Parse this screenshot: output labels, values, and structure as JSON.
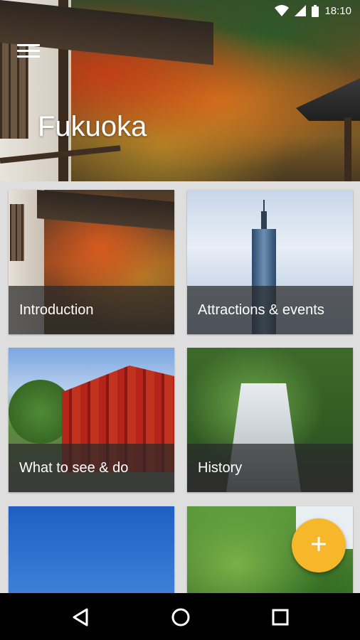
{
  "status_bar": {
    "time": "18:10",
    "icons": [
      "wifi-icon",
      "cell-signal-icon",
      "battery-icon"
    ]
  },
  "header": {
    "city_name": "Fukuoka",
    "menu_icon": "hamburger-menu-icon"
  },
  "cards": [
    {
      "label": "Introduction",
      "image": "autumn-temple-photo"
    },
    {
      "label": "Attractions & events",
      "image": "fukuoka-tower-photo"
    },
    {
      "label": "What to see & do",
      "image": "red-shrine-photo"
    },
    {
      "label": "History",
      "image": "waterfall-photo"
    },
    {
      "label": "",
      "image": "blue-sky-photo"
    },
    {
      "label": "",
      "image": "forest-photo"
    }
  ],
  "fab": {
    "icon": "plus-icon",
    "color": "#f6b72a"
  },
  "nav_bar": {
    "icons": [
      "back-icon",
      "home-icon",
      "recent-apps-icon"
    ]
  }
}
